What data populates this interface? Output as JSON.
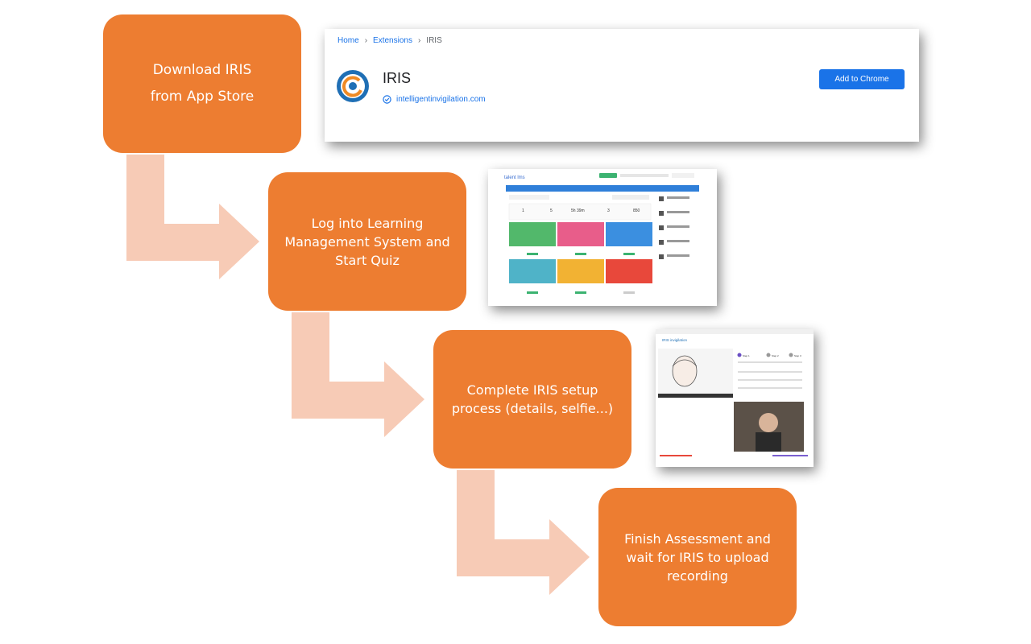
{
  "steps": [
    {
      "text": "Download IRIS\nfrom App Store"
    },
    {
      "text": "Log into Learning\nManagement System and\nStart Quiz"
    },
    {
      "text": "Complete IRIS setup\nprocess (details, selfie...)"
    },
    {
      "text": "Finish Assessment and\nwait for IRIS to upload\nrecording"
    }
  ],
  "store_screenshot": {
    "breadcrumb": [
      "Home",
      "Extensions",
      "IRIS"
    ],
    "app_name": "IRIS",
    "website": "intelligentinvigilation.com",
    "add_button": "Add to Chrome"
  },
  "lms_screenshot": {
    "brand": "talent lms",
    "stats": [
      "1",
      "5",
      "5h 39m",
      "3",
      "850"
    ]
  },
  "setup_screenshot": {
    "brand": "IRIS invigilation",
    "steps": [
      "Step 1",
      "Step 2",
      "Step 3"
    ]
  },
  "colors": {
    "step_fill": "#ED7D31",
    "arrow_fill": "#F7CBB6",
    "link": "#1a73e8"
  }
}
